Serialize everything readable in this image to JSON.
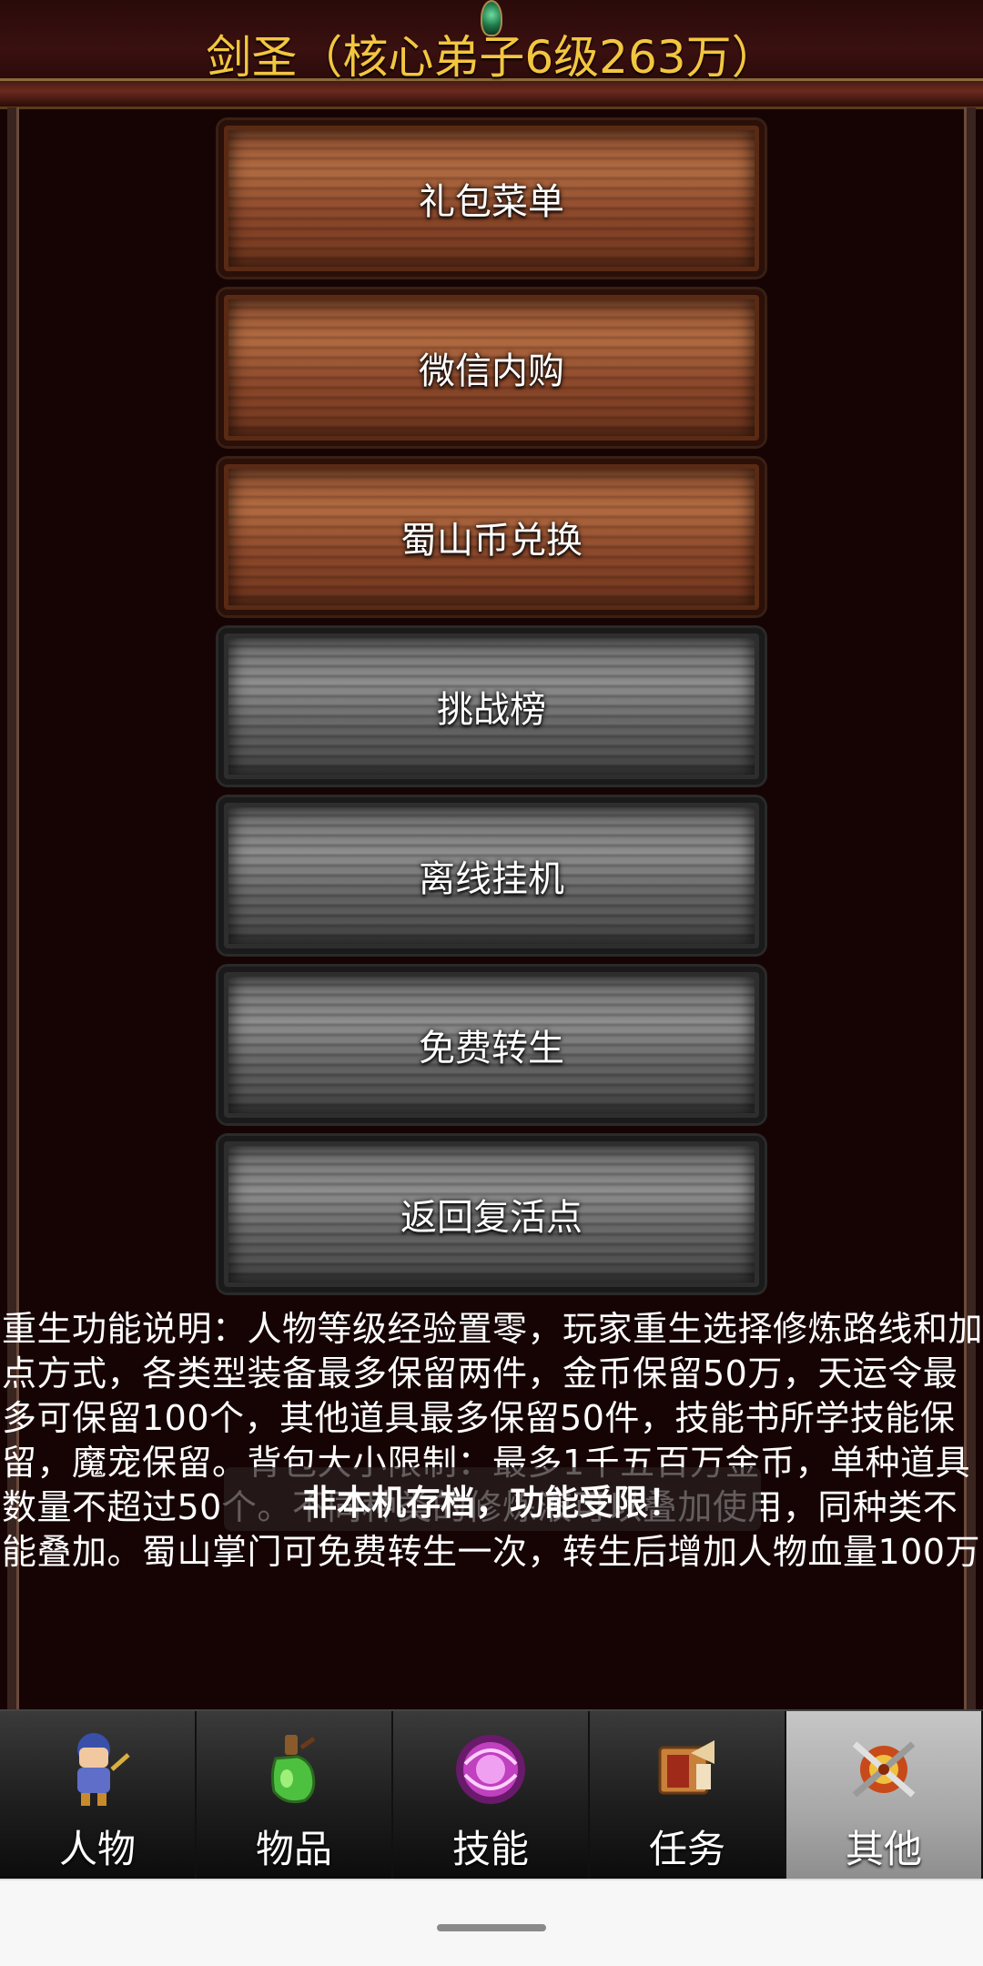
{
  "header": {
    "title": "剑圣（核心弟子6级263万）"
  },
  "menu": {
    "items": [
      {
        "label": "礼包菜单",
        "style": "wood"
      },
      {
        "label": "微信内购",
        "style": "wood"
      },
      {
        "label": "蜀山币兑换",
        "style": "wood"
      },
      {
        "label": "挑战榜",
        "style": "stone"
      },
      {
        "label": "离线挂机",
        "style": "stone"
      },
      {
        "label": "免费转生",
        "style": "stone"
      },
      {
        "label": "返回复活点",
        "style": "stone"
      }
    ]
  },
  "description": {
    "text": "重生功能说明：人物等级经验置零，玩家重生选择修炼路线和加点方式，各类型装备最多保留两件，金币保留50万，天运令最多可保留100个，其他道具最多保留50件，技能书所学技能保留，魔宠保留。背包大小限制：最多1千五百万金币，单种道具数量不超过50个。不同种类的修炼液可以叠加使用，同种类不能叠加。蜀山掌门可免费转生一次，转生后增加人物血量100万"
  },
  "toast": {
    "text": "非本机存档，功能受限！"
  },
  "nav": {
    "items": [
      {
        "label": "人物",
        "icon": "character-icon"
      },
      {
        "label": "物品",
        "icon": "potion-icon"
      },
      {
        "label": "技能",
        "icon": "skill-orb-icon"
      },
      {
        "label": "任务",
        "icon": "quest-scroll-icon"
      },
      {
        "label": "其他",
        "icon": "crossed-swords-icon"
      }
    ],
    "active_index": 4
  },
  "colors": {
    "title": "#f3c640",
    "background": "#160405",
    "nav_active": "#a8a8a8"
  }
}
